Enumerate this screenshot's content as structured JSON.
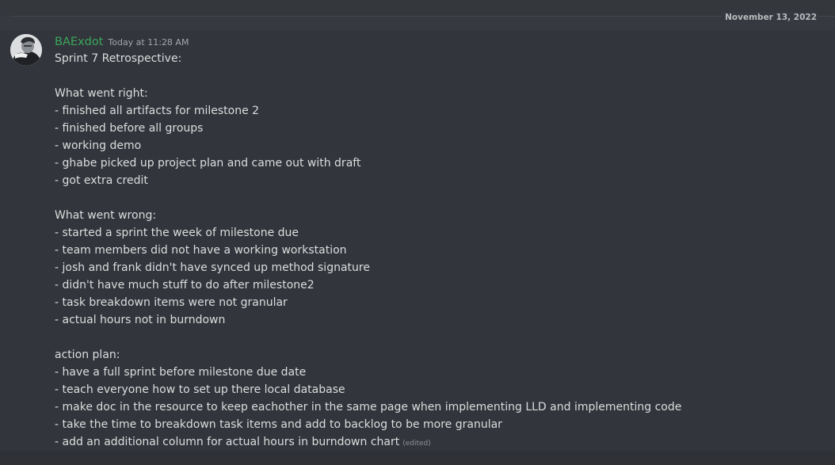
{
  "date_divider": {
    "label": "November 13, 2022"
  },
  "message": {
    "author": "BAExdot",
    "timestamp": "Today at 11:28 AM",
    "author_color": "#3ba55c",
    "avatar_icon": "user-avatar-photo",
    "lines": [
      "Sprint 7 Retrospective:",
      "",
      "What went right:",
      "- finished all artifacts for milestone 2",
      "- finished before all groups",
      "- working demo",
      "- ghabe picked up project plan and came out with draft",
      "- got extra credit",
      "",
      "What went wrong:",
      "- started a sprint the week of milestone due",
      "- team members did not have a working workstation",
      "- josh and frank didn't have synced up method signature",
      "- didn't have much stuff to do after milestone2",
      "- task breakdown items were not granular",
      "- actual hours not in burndown",
      "",
      "action plan:",
      "- have a full sprint before milestone due date",
      "- teach everyone how to set up there local database",
      "- make doc in the resource to keep eachother in the same page when implementing LLD and implementing code",
      "- take the time to breakdown task items and add to backlog to be more granular",
      "- add an additional column for actual hours in burndown chart"
    ],
    "edited_label": "(edited)"
  }
}
